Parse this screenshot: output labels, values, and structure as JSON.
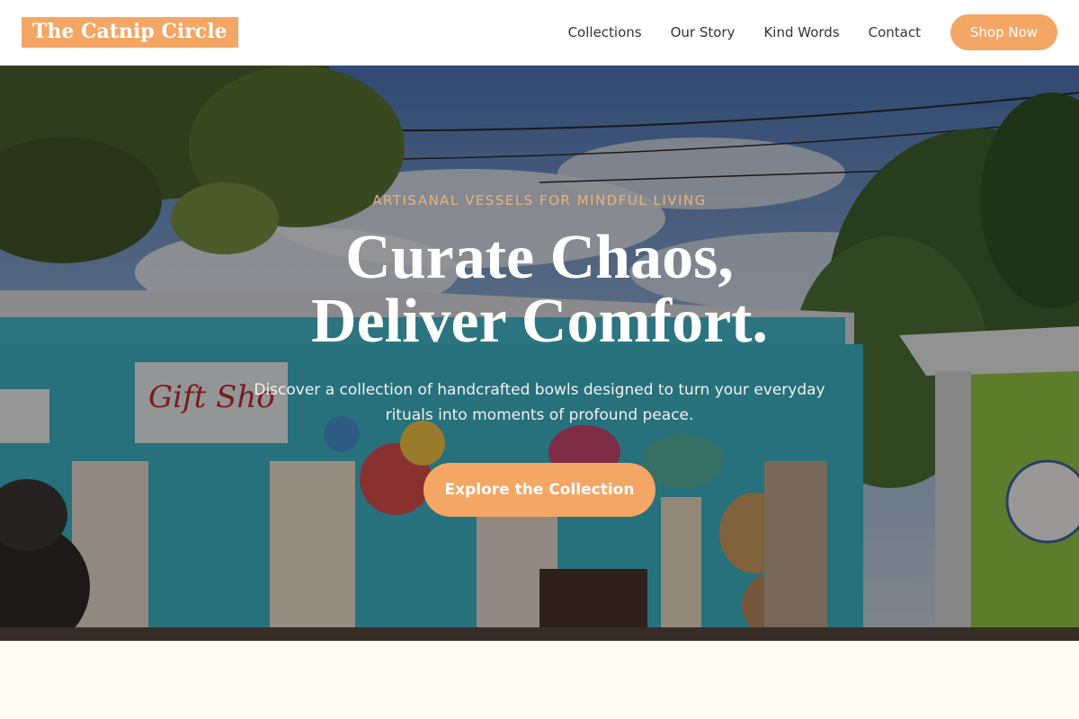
{
  "nav": {
    "logo": "The Catnip Circle",
    "links": [
      "Collections",
      "Our Story",
      "Kind Words",
      "Contact"
    ],
    "cta": "Shop Now"
  },
  "hero": {
    "eyebrow": "ARTISANAL VESSELS FOR MINDFUL LIVING",
    "headline_line1": "Curate Chaos,",
    "headline_line2": "Deliver Comfort.",
    "subtext": "Discover a collection of handcrafted bowls designed to turn your everyday rituals into moments of profound peace.",
    "cta": "Explore the Collection",
    "background_image": "street-market-gift-shop-photo"
  },
  "colors": {
    "accent": "#f4a664",
    "eyebrow": "#e8b27d",
    "page_bg": "#fdfcf3",
    "shop_teal": "#2eb4c9",
    "shop_green": "#8cc63f"
  }
}
